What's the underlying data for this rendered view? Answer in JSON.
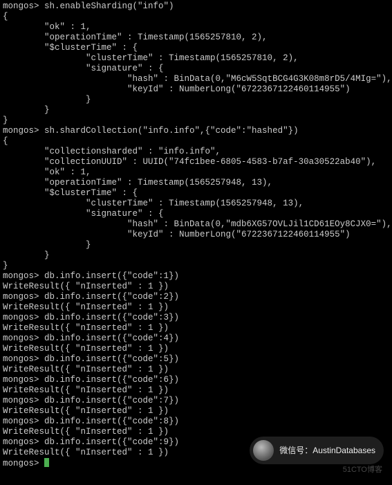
{
  "lines": [
    "mongos> sh.enableSharding(\"info\")",
    "{",
    "        \"ok\" : 1,",
    "        \"operationTime\" : Timestamp(1565257810, 2),",
    "        \"$clusterTime\" : {",
    "                \"clusterTime\" : Timestamp(1565257810, 2),",
    "                \"signature\" : {",
    "                        \"hash\" : BinData(0,\"M6cW5SqtBCG4G3K08m8rD5/4MIg=\"),",
    "                        \"keyId\" : NumberLong(\"6722367122460114955\")",
    "                }",
    "        }",
    "}",
    "mongos> sh.shardCollection(\"info.info\",{\"code\":\"hashed\"})",
    "{",
    "        \"collectionsharded\" : \"info.info\",",
    "        \"collectionUUID\" : UUID(\"74fc1bee-6805-4583-b7af-30a30522ab40\"),",
    "        \"ok\" : 1,",
    "        \"operationTime\" : Timestamp(1565257948, 13),",
    "        \"$clusterTime\" : {",
    "                \"clusterTime\" : Timestamp(1565257948, 13),",
    "                \"signature\" : {",
    "                        \"hash\" : BinData(0,\"mdb6XG57OVLJil1CD61EOy8CJX0=\"),",
    "                        \"keyId\" : NumberLong(\"6722367122460114955\")",
    "                }",
    "        }",
    "}",
    "mongos> db.info.insert({\"code\":1})",
    "WriteResult({ \"nInserted\" : 1 })",
    "mongos> db.info.insert({\"code\":2})",
    "WriteResult({ \"nInserted\" : 1 })",
    "mongos> db.info.insert({\"code\":3})",
    "WriteResult({ \"nInserted\" : 1 })",
    "mongos> db.info.insert({\"code\":4})",
    "WriteResult({ \"nInserted\" : 1 })",
    "mongos> db.info.insert({\"code\":5})",
    "WriteResult({ \"nInserted\" : 1 })",
    "mongos> db.info.insert({\"code\":6})",
    "WriteResult({ \"nInserted\" : 1 })",
    "mongos> db.info.insert({\"code\":7})",
    "WriteResult({ \"nInserted\" : 1 })",
    "mongos> db.info.insert({\"code\":8})",
    "WriteResult({ \"nInserted\" : 1 })",
    "mongos> db.info.insert({\"code\":9})",
    "WriteResult({ \"nInserted\" : 1 })"
  ],
  "final_prompt": "mongos> ",
  "overlay": {
    "label": "微信号：AustinDatabases"
  },
  "brand_watermark": "51CTO博客"
}
